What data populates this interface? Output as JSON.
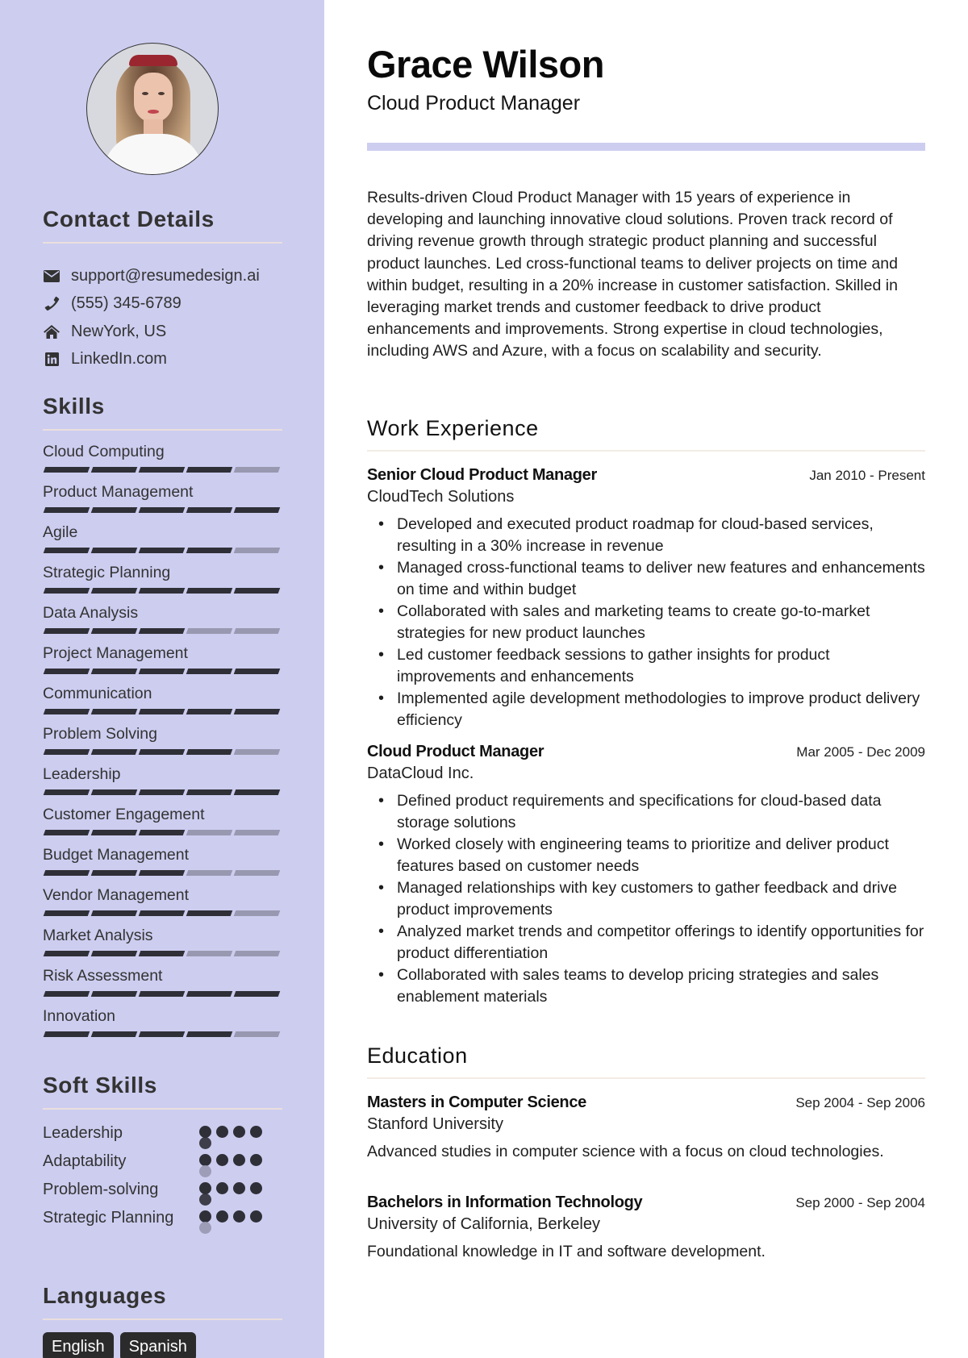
{
  "profile": {
    "name": "Grace Wilson",
    "title": "Cloud Product Manager",
    "photo_alt": "profile-photo"
  },
  "colors": {
    "sidebar_bg": "#cdcdf0",
    "accent_bar": "#cdcdf0",
    "bar_filled": "#2f2f37",
    "bar_empty": "#9898b0",
    "badge_bg": "#2b2b2b"
  },
  "contact": {
    "heading": "Contact Details",
    "items": [
      {
        "icon": "envelope-icon",
        "text": "support@resumedesign.ai"
      },
      {
        "icon": "phone-icon",
        "text": "(555) 345-6789"
      },
      {
        "icon": "home-icon",
        "text": "NewYork, US"
      },
      {
        "icon": "linkedin-icon",
        "text": "LinkedIn.com"
      }
    ]
  },
  "skills": {
    "heading": "Skills",
    "max_level": 5,
    "items": [
      {
        "name": "Cloud Computing",
        "level": 4
      },
      {
        "name": "Product Management",
        "level": 5
      },
      {
        "name": "Agile",
        "level": 4
      },
      {
        "name": "Strategic Planning",
        "level": 5
      },
      {
        "name": "Data Analysis",
        "level": 3
      },
      {
        "name": "Project Management",
        "level": 5
      },
      {
        "name": "Communication",
        "level": 5
      },
      {
        "name": "Problem Solving",
        "level": 4
      },
      {
        "name": "Leadership",
        "level": 5
      },
      {
        "name": "Customer Engagement",
        "level": 3
      },
      {
        "name": "Budget Management",
        "level": 3
      },
      {
        "name": "Vendor Management",
        "level": 4
      },
      {
        "name": "Market Analysis",
        "level": 3
      },
      {
        "name": "Risk Assessment",
        "level": 5
      },
      {
        "name": "Innovation",
        "level": 4
      }
    ]
  },
  "soft_skills": {
    "heading": "Soft Skills",
    "max_level": 5,
    "items": [
      {
        "name": "Leadership",
        "level": 5
      },
      {
        "name": "Adaptability",
        "level": 4
      },
      {
        "name": "Problem-solving",
        "level": 5
      },
      {
        "name": "Strategic Planning",
        "level": 4
      }
    ]
  },
  "languages": {
    "heading": "Languages",
    "items": [
      "English",
      "Spanish"
    ]
  },
  "summary": "Results-driven Cloud Product Manager with 15 years of experience in developing and launching innovative cloud solutions. Proven track record of driving revenue growth through strategic product planning and successful product launches. Led cross-functional teams to deliver projects on time and within budget, resulting in a 20% increase in customer satisfaction. Skilled in leveraging market trends and customer feedback to drive product enhancements and improvements. Strong expertise in cloud technologies, including AWS and Azure, with a focus on scalability and security.",
  "experience": {
    "heading": "Work Experience",
    "items": [
      {
        "title": "Senior Cloud Product Manager",
        "company": "CloudTech Solutions",
        "dates": "Jan 2010 - Present",
        "bullets": [
          "Developed and executed product roadmap for cloud-based services, resulting in a 30% increase in revenue",
          "Managed cross-functional teams to deliver new features and enhancements on time and within budget",
          "Collaborated with sales and marketing teams to create go-to-market strategies for new product launches",
          "Led customer feedback sessions to gather insights for product improvements and enhancements",
          "Implemented agile development methodologies to improve product delivery efficiency"
        ]
      },
      {
        "title": "Cloud Product Manager",
        "company": "DataCloud Inc.",
        "dates": "Mar 2005 - Dec 2009",
        "bullets": [
          "Defined product requirements and specifications for cloud-based data storage solutions",
          "Worked closely with engineering teams to prioritize and deliver product features based on customer needs",
          "Managed relationships with key customers to gather feedback and drive product improvements",
          "Analyzed market trends and competitor offerings to identify opportunities for product differentiation",
          "Collaborated with sales teams to develop pricing strategies and sales enablement materials"
        ]
      }
    ]
  },
  "education": {
    "heading": "Education",
    "items": [
      {
        "degree": "Masters in Computer Science",
        "school": "Stanford University",
        "dates": "Sep 2004 - Sep 2006",
        "description": "Advanced studies in computer science with a focus on cloud technologies."
      },
      {
        "degree": "Bachelors in Information Technology",
        "school": "University of California, Berkeley",
        "dates": "Sep 2000 - Sep 2004",
        "description": "Foundational knowledge in IT and software development."
      }
    ]
  }
}
